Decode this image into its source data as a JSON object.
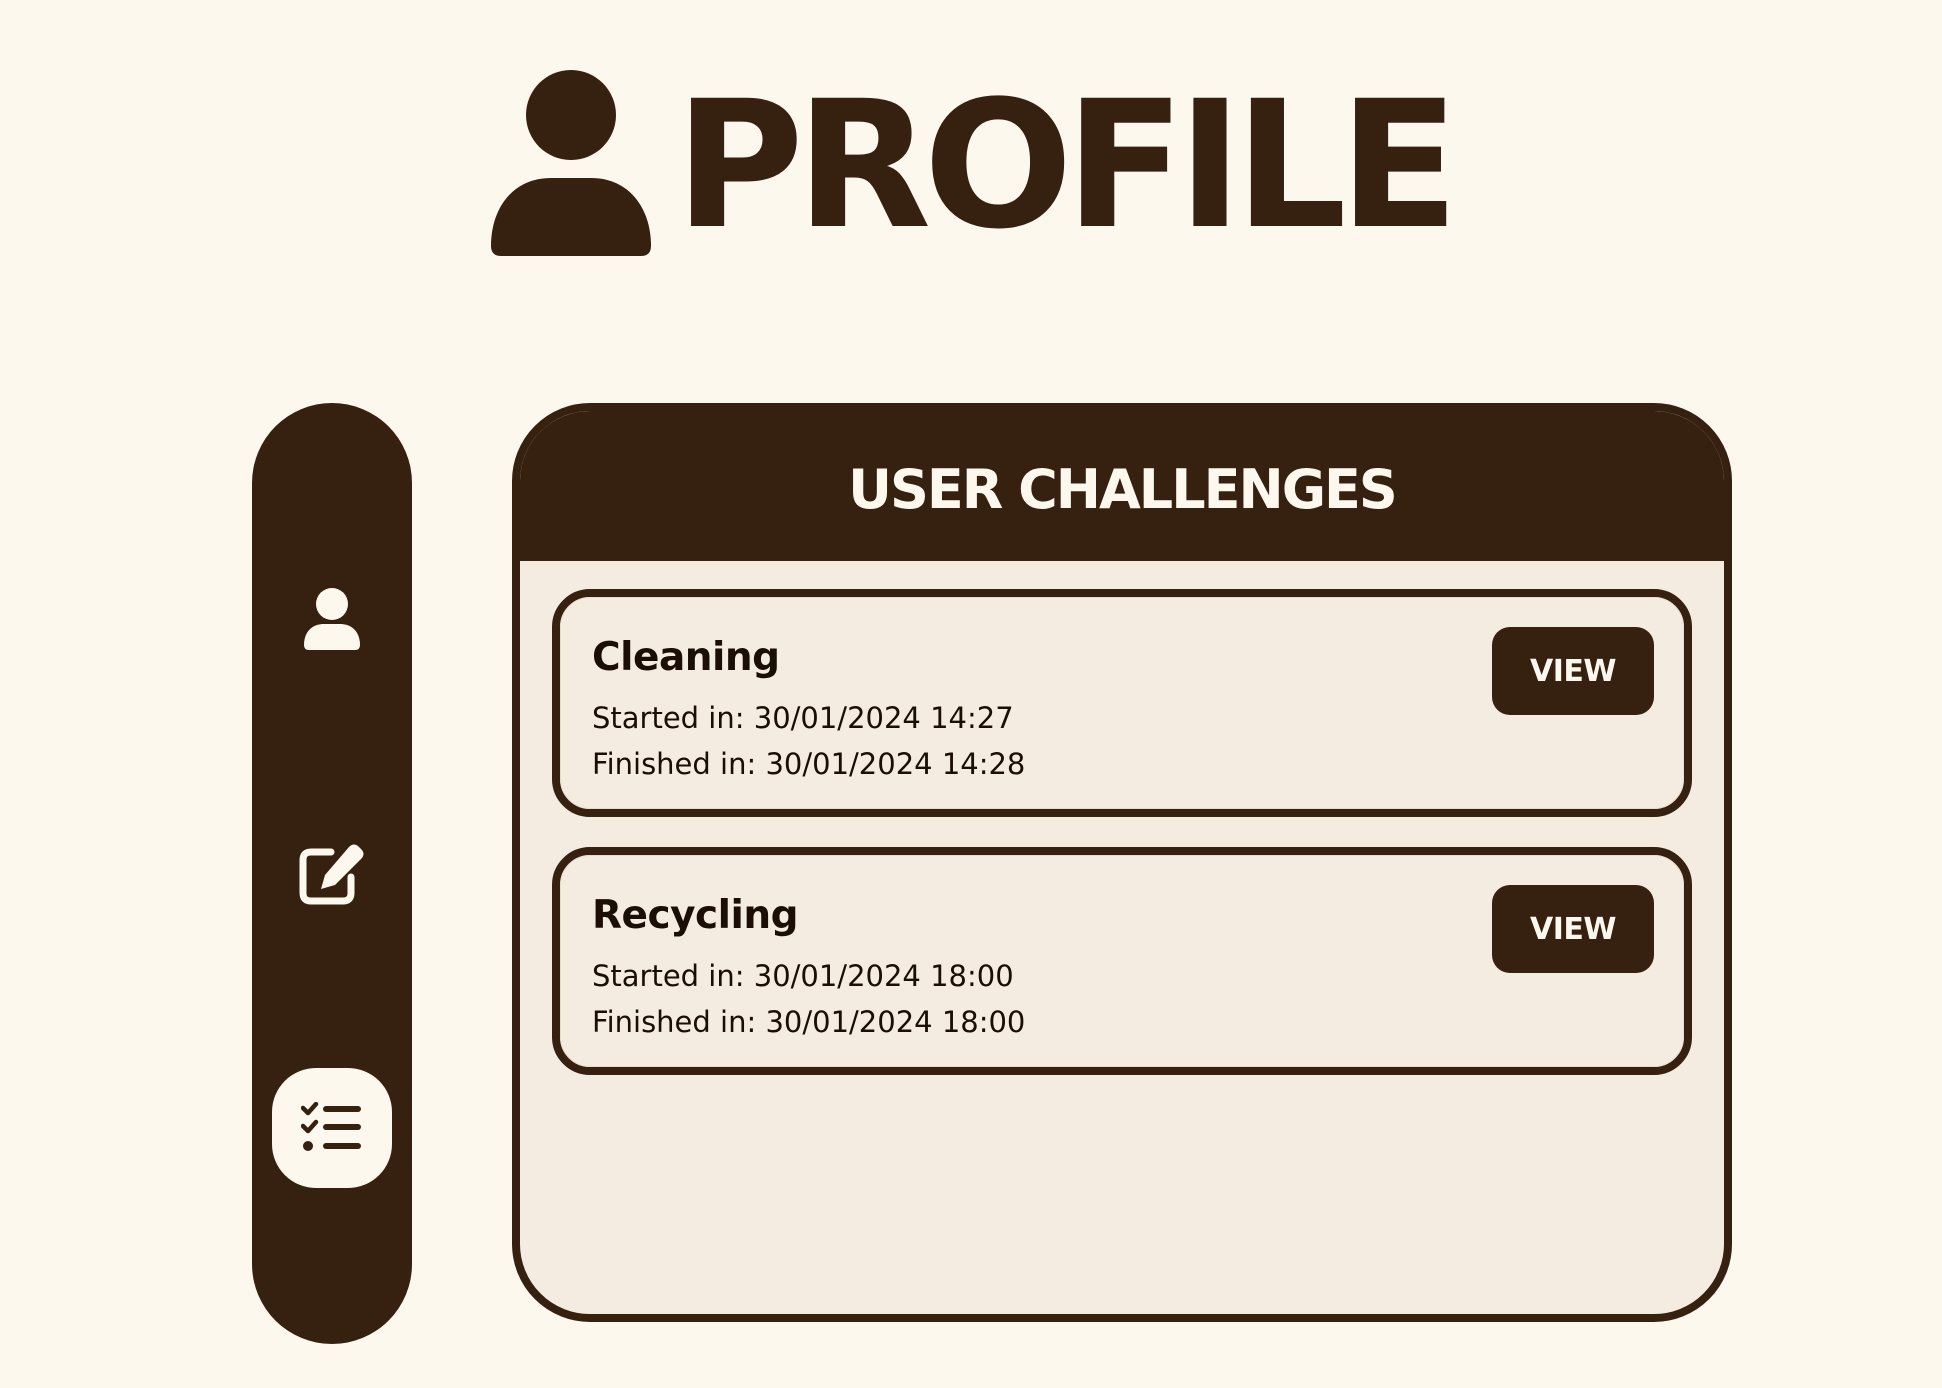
{
  "header": {
    "title": "PROFILE",
    "icon": "user-icon"
  },
  "sidebar": {
    "items": [
      {
        "name": "profile",
        "icon": "user-icon",
        "active": false
      },
      {
        "name": "edit-profile",
        "icon": "edit-icon",
        "active": false
      },
      {
        "name": "challenges",
        "icon": "checklist-icon",
        "active": true
      }
    ]
  },
  "panel": {
    "title": "USER CHALLENGES",
    "challenges": [
      {
        "name": "Cleaning",
        "started": "Started in: 30/01/2024 14:27",
        "finished": "Finished in: 30/01/2024 14:28",
        "button_label": "VIEW"
      },
      {
        "name": "Recycling",
        "started": "Started in: 30/01/2024 18:00",
        "finished": "Finished in: 30/01/2024 18:00",
        "button_label": "VIEW"
      }
    ]
  },
  "colors": {
    "background": "#fdf8ee",
    "primary": "#36200f",
    "panel_background": "#f5ece1",
    "text": "#1a0e06"
  }
}
